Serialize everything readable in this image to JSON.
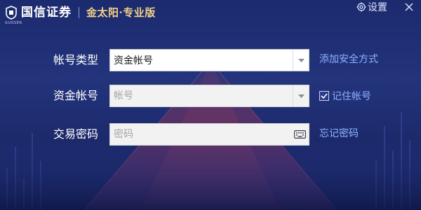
{
  "title_bar": {
    "brand_name": "国信证券",
    "brand_en": "GUOSEN",
    "product_name": "金太阳·专业版",
    "settings_label": "设置",
    "settings_icon": "gear-icon",
    "close_icon": "close-icon"
  },
  "form": {
    "account_type": {
      "label": "帐号类型",
      "value": "资金帐号",
      "side_link": "添加安全方式"
    },
    "fund_account": {
      "label": "资金帐号",
      "placeholder": "帐号",
      "remember_label": "记住帐号",
      "remember_checked": true
    },
    "password": {
      "label": "交易密码",
      "placeholder": "密码",
      "side_link": "忘记密码",
      "keyboard_icon": "keyboard-icon"
    }
  },
  "colors": {
    "background": "#1f2f74",
    "link": "#8fb3ff",
    "product_gold": "#f1d287",
    "accent_red": "#c23b4a"
  }
}
